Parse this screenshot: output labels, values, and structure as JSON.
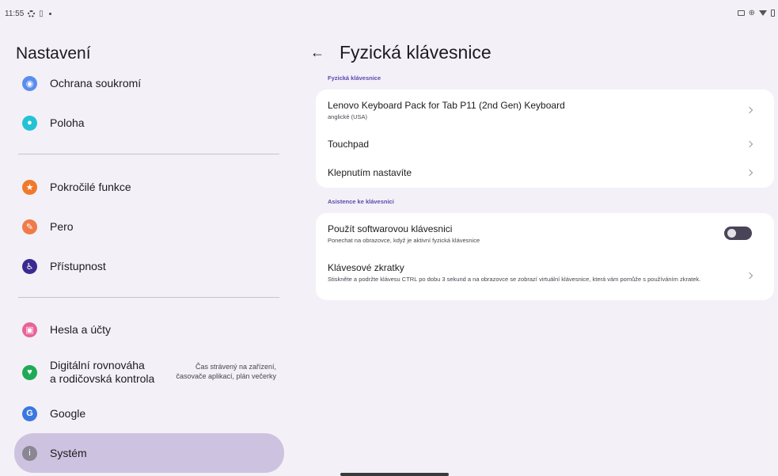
{
  "status_bar": {
    "time": "11:55",
    "left_icons": [
      "gear-icon",
      "sim-icon",
      "dot-icon"
    ],
    "right_icons": [
      "screencast-icon",
      "vibrate-icon",
      "wifi-icon",
      "battery-icon"
    ]
  },
  "left_panel": {
    "title": "Nastavení",
    "items": [
      {
        "label": "Ochrana soukromí",
        "icon": "privacy-icon",
        "color": "#5b8def",
        "glyph": "◉"
      },
      {
        "label": "Poloha",
        "icon": "location-icon",
        "color": "#25c2d6",
        "glyph": "●"
      },
      {
        "label": "Pokročilé funkce",
        "icon": "star-icon",
        "color": "#f07a2c",
        "glyph": "★"
      },
      {
        "label": "Pero",
        "icon": "pen-icon",
        "color": "#f07a4a",
        "glyph": "✎"
      },
      {
        "label": "Přístupnost",
        "icon": "accessibility-icon",
        "color": "#3b2a8f",
        "glyph": "♿"
      },
      {
        "label": "Hesla a účty",
        "icon": "accounts-icon",
        "color": "#e8639a",
        "glyph": "▣"
      },
      {
        "label": "Digitální rovnováha",
        "label2": "a rodičovská kontrola",
        "icon": "wellbeing-icon",
        "color": "#1faa57",
        "glyph": "♥",
        "summary": "Čas strávený na zařízení,",
        "summary2": "časovače aplikací, plán večerky"
      },
      {
        "label": "Google",
        "icon": "google-icon",
        "color": "#3a78e0",
        "glyph": "G"
      },
      {
        "label": "Systém",
        "icon": "system-icon",
        "color": "#8b8792",
        "glyph": "i"
      }
    ]
  },
  "right_panel": {
    "title": "Fyzická klávesnice",
    "section1": "Fyzická klávesnice",
    "keyboard": {
      "title": "Lenovo Keyboard Pack for Tab P11 (2nd Gen) Keyboard",
      "subtitle": "anglické (USA)"
    },
    "touchpad": {
      "title": "Touchpad"
    },
    "tap_to_set": {
      "title": "Klepnutím nastavíte"
    },
    "section2": "Asistence ke klávesnici",
    "software_kb": {
      "title": "Použít softwarovou klávesnici",
      "subtitle": "Ponechat na obrazovce, když je aktivní fyzická klávesnice",
      "toggle_on": false
    },
    "shortcuts": {
      "title": "Klávesové zkratky",
      "subtitle": "Stiskněte a podržte klávesu CTRL po dobu 3 sekund a na obrazovce se zobrazí virtuální klávesnice, která vám pomůže s používáním zkratek."
    }
  }
}
